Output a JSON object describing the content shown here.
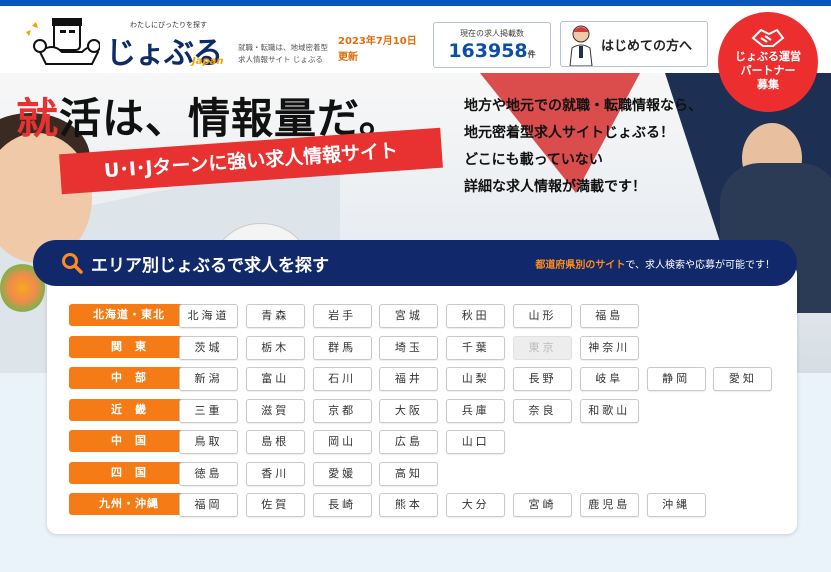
{
  "header": {
    "tagline": "わたしにぴったりを探す",
    "logo_text": "じょぶる",
    "logo_sub": "Japan",
    "description": "就職・転職は、地域密着型求人情報サイト じょぶる",
    "date": "2023年7月10日更新",
    "count_label": "現在の求人掲載数",
    "count_value": "163958",
    "count_unit": "件",
    "first_time_label": "はじめての方へ",
    "partner_label": "じょぶる運営\nパートナー\n募集"
  },
  "hero": {
    "headline_red": "就",
    "headline_rest": "活は、情報量だ。",
    "ribbon": "U･I･Jターンに強い求人情報サイト",
    "lead_lines": [
      "地方や地元での就職・転職情報なら、",
      "地元密着型求人サイトじょぶる！",
      "どこにも載っていない",
      "詳細な求人情報が満載です！"
    ]
  },
  "search": {
    "title": "エリア別じょぶるで求人を探す",
    "note_highlight": "都道府県別のサイト",
    "note_rest": "で、求人検索や応募が可能です！"
  },
  "regions": [
    {
      "label": "北海道・東北",
      "prefs": [
        {
          "name": "北海道"
        },
        {
          "name": "青森"
        },
        {
          "name": "岩手"
        },
        {
          "name": "宮城"
        },
        {
          "name": "秋田"
        },
        {
          "name": "山形"
        },
        {
          "name": "福島"
        }
      ]
    },
    {
      "label": "関　東",
      "prefs": [
        {
          "name": "茨城"
        },
        {
          "name": "栃木"
        },
        {
          "name": "群馬"
        },
        {
          "name": "埼玉"
        },
        {
          "name": "千葉"
        },
        {
          "name": "東京",
          "disabled": true
        },
        {
          "name": "神奈川"
        }
      ]
    },
    {
      "label": "中　部",
      "prefs": [
        {
          "name": "新潟"
        },
        {
          "name": "富山"
        },
        {
          "name": "石川"
        },
        {
          "name": "福井"
        },
        {
          "name": "山梨"
        },
        {
          "name": "長野"
        },
        {
          "name": "岐阜"
        },
        {
          "name": "静岡"
        },
        {
          "name": "愛知"
        }
      ]
    },
    {
      "label": "近　畿",
      "prefs": [
        {
          "name": "三重"
        },
        {
          "name": "滋賀"
        },
        {
          "name": "京都"
        },
        {
          "name": "大阪"
        },
        {
          "name": "兵庫"
        },
        {
          "name": "奈良"
        },
        {
          "name": "和歌山"
        }
      ]
    },
    {
      "label": "中　国",
      "prefs": [
        {
          "name": "鳥取"
        },
        {
          "name": "島根"
        },
        {
          "name": "岡山"
        },
        {
          "name": "広島"
        },
        {
          "name": "山口"
        }
      ]
    },
    {
      "label": "四　国",
      "prefs": [
        {
          "name": "徳島"
        },
        {
          "name": "香川"
        },
        {
          "name": "愛媛"
        },
        {
          "name": "高知"
        }
      ]
    },
    {
      "label": "九州・沖縄",
      "prefs": [
        {
          "name": "福岡"
        },
        {
          "name": "佐賀"
        },
        {
          "name": "長崎"
        },
        {
          "name": "熊本"
        },
        {
          "name": "大分"
        },
        {
          "name": "宮崎"
        },
        {
          "name": "鹿児島"
        },
        {
          "name": "沖縄"
        }
      ]
    }
  ],
  "colors": {
    "brand_navy": "#11296b",
    "accent_orange": "#f47b16",
    "accent_red": "#e83232",
    "count_blue": "#0d4fa6"
  }
}
